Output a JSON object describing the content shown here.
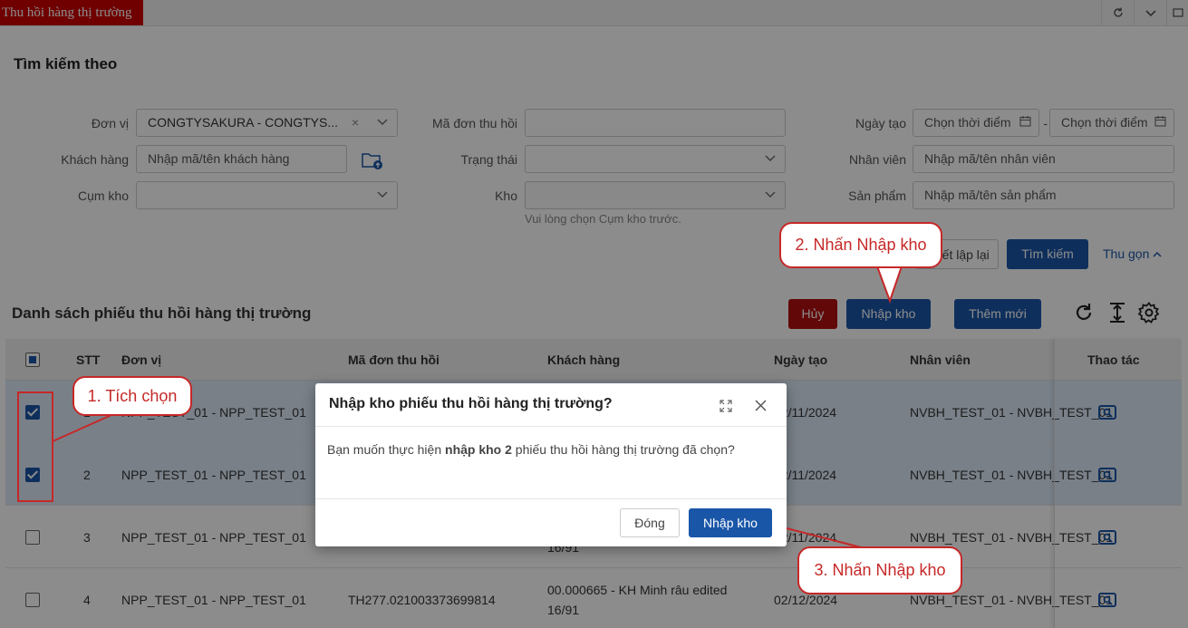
{
  "topbar": {
    "tab_label": "Thu hồi hàng thị trường"
  },
  "search": {
    "title": "Tìm kiếm theo",
    "don_vi_label": "Đơn vị",
    "don_vi_value": "CONGTYSAKURA - CONGTYS...",
    "ma_don_label": "Mã đơn thu hồi",
    "ngay_tao_label": "Ngày tạo",
    "from_placeholder": "Chọn thời điểm",
    "date_sep": "-",
    "to_placeholder": "Chọn thời điểm",
    "khach_hang_label": "Khách hàng",
    "khach_hang_placeholder": "Nhập mã/tên khách hàng",
    "trang_thai_label": "Trạng thái",
    "nhan_vien_label": "Nhân viên",
    "nhan_vien_placeholder": "Nhập mã/tên nhân viên",
    "cum_kho_label": "Cụm kho",
    "kho_label": "Kho",
    "san_pham_label": "Sản phẩm",
    "san_pham_placeholder": "Nhập mã/tên sản phẩm",
    "kho_hint": "Vui lòng chọn Cụm kho trước.",
    "reset_label": "Thiết lập lại",
    "search_label": "Tìm kiếm",
    "collapse_label": "Thu gọn"
  },
  "list": {
    "title": "Danh sách phiếu thu hồi hàng thị trường",
    "cancel_label": "Hủy",
    "import_label": "Nhập kho",
    "add_label": "Thêm mới",
    "columns": [
      "STT",
      "Đơn vị",
      "Mã đơn thu hồi",
      "Khách hàng",
      "Ngày tạo",
      "Nhân viên",
      "Thao tác"
    ],
    "rows": [
      {
        "stt": "1",
        "don_vi": "NPP_TEST_01 - NPP_TEST_01",
        "ma_don": "",
        "khach_hang": "",
        "khach_hang_2": "",
        "ngay_tao": "02/11/2024",
        "nhan_vien": "NVBH_TEST_01 - NVBH_TEST_01",
        "checked": true
      },
      {
        "stt": "2",
        "don_vi": "NPP_TEST_01 - NPP_TEST_01",
        "ma_don": "",
        "khach_hang": "",
        "khach_hang_2": "",
        "ngay_tao": "02/11/2024",
        "nhan_vien": "NVBH_TEST_01 - NVBH_TEST_01",
        "checked": true
      },
      {
        "stt": "3",
        "don_vi": "NPP_TEST_01 - NPP_TEST_01",
        "ma_don": "",
        "khach_hang": "",
        "khach_hang_2": "16/91",
        "ngay_tao": "02/11/2024",
        "nhan_vien": "NVBH_TEST_01 - NVBH_TEST_01",
        "checked": false
      },
      {
        "stt": "4",
        "don_vi": "NPP_TEST_01 - NPP_TEST_01",
        "ma_don": "TH277.021003373699814",
        "khach_hang": "00.000665 - KH Minh râu edited",
        "khach_hang_2": "16/91",
        "ngay_tao": "02/12/2024",
        "nhan_vien": "NVBH_TEST_01 - NVBH_TEST_01",
        "checked": false
      }
    ]
  },
  "modal": {
    "title": "Nhập kho phiếu thu hồi hàng thị trường?",
    "body_prefix": "Bạn muốn thực hiện ",
    "body_bold": "nhập kho 2",
    "body_suffix": " phiếu thu hồi hàng thị trường đã chọn?",
    "close_label": "Đóng",
    "confirm_label": "Nhập kho"
  },
  "callouts": {
    "step1": "1. Tích chọn",
    "step2": "2. Nhấn Nhập kho",
    "step3": "3. Nhấn Nhập kho"
  },
  "colors": {
    "brand_blue": "#1a56a8",
    "danger_red": "#b30f10",
    "annotation_red": "#c62828"
  }
}
